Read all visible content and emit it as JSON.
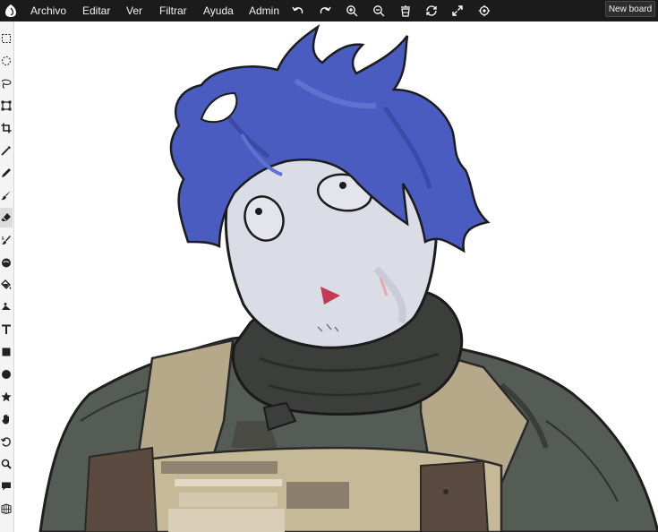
{
  "menu": {
    "items": [
      {
        "id": "archivo",
        "label": "Archivo"
      },
      {
        "id": "editar",
        "label": "Editar"
      },
      {
        "id": "ver",
        "label": "Ver"
      },
      {
        "id": "filtrar",
        "label": "Filtrar"
      },
      {
        "id": "ayuda",
        "label": "Ayuda"
      },
      {
        "id": "admin",
        "label": "Admin"
      }
    ]
  },
  "toolbar": {
    "icons": [
      "undo-icon",
      "redo-icon",
      "zoom-in-icon",
      "zoom-out-icon",
      "clean-icon",
      "sync-icon",
      "fullscreen-icon",
      "settings-icon"
    ],
    "new_board_label": "New board"
  },
  "sidebar": {
    "tools": [
      "rect-select-icon",
      "ellipse-select-icon",
      "lasso-icon",
      "transform-icon",
      "crop-icon",
      "eyedropper-icon",
      "pencil-icon",
      "brush-icon",
      "eraser-icon",
      "smudge-icon",
      "blur-icon",
      "fill-icon",
      "gradient-icon",
      "text-icon",
      "rectangle-icon",
      "ellipse-icon",
      "shape-icon",
      "hand-icon",
      "rotate-icon",
      "zoom-icon",
      "comment-icon",
      "grid-icon"
    ],
    "active_tool": "eraser-icon"
  },
  "colors": {
    "topbar_bg": "#1b1b1b",
    "hair": "#4a5cc0",
    "skin": "#dadce6",
    "scarf": "#3b3e3b",
    "jacket": "#555b55",
    "vest": "#b6a98a",
    "mouth": "#c43a55"
  }
}
